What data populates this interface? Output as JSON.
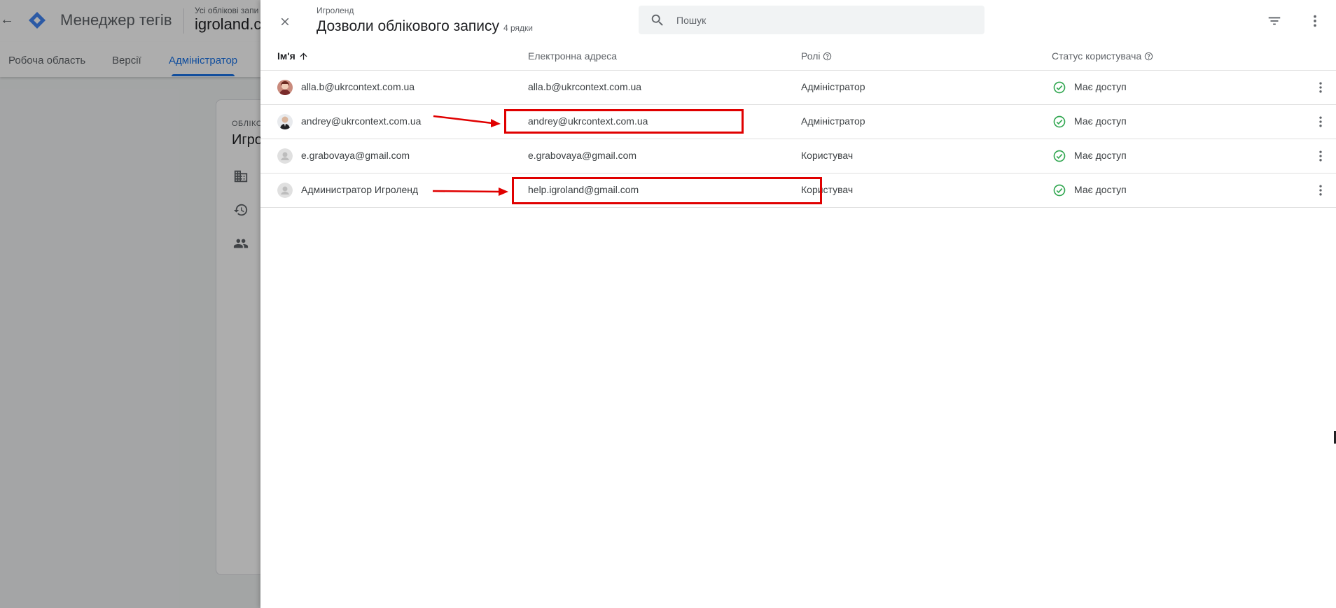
{
  "background": {
    "app_title": "Менеджер тегів",
    "account_small": "Усі облікові запи",
    "account_name": "igroland.c",
    "tabs": [
      "Робоча область",
      "Версії",
      "Адміністратор"
    ],
    "card_small": "ОБЛІКО",
    "card_title": "Игро"
  },
  "panel": {
    "subtitle": "Игроленд",
    "title": "Дозволи облікового запису",
    "row_count": "4 рядки",
    "search_placeholder": "Пошук",
    "columns": {
      "name": "Ім'я",
      "email": "Електронна адреса",
      "roles": "Ролі",
      "status": "Статус користувача"
    },
    "rows": [
      {
        "name": "alla.b@ukrcontext.com.ua",
        "email": "alla.b@ukrcontext.com.ua",
        "role": "Адміністратор",
        "status": "Має доступ"
      },
      {
        "name": "andrey@ukrcontext.com.ua",
        "email": "andrey@ukrcontext.com.ua",
        "role": "Адміністратор",
        "status": "Має доступ"
      },
      {
        "name": "e.grabovaya@gmail.com",
        "email": "e.grabovaya@gmail.com",
        "role": "Користувач",
        "status": "Має доступ"
      },
      {
        "name": "Администратор Игроленд",
        "email": "help.igroland@gmail.com",
        "role": "Користувач",
        "status": "Має доступ"
      }
    ]
  },
  "colors": {
    "accent": "#1a73e8",
    "status_ok": "#34a853",
    "annotation": "#e00000"
  }
}
